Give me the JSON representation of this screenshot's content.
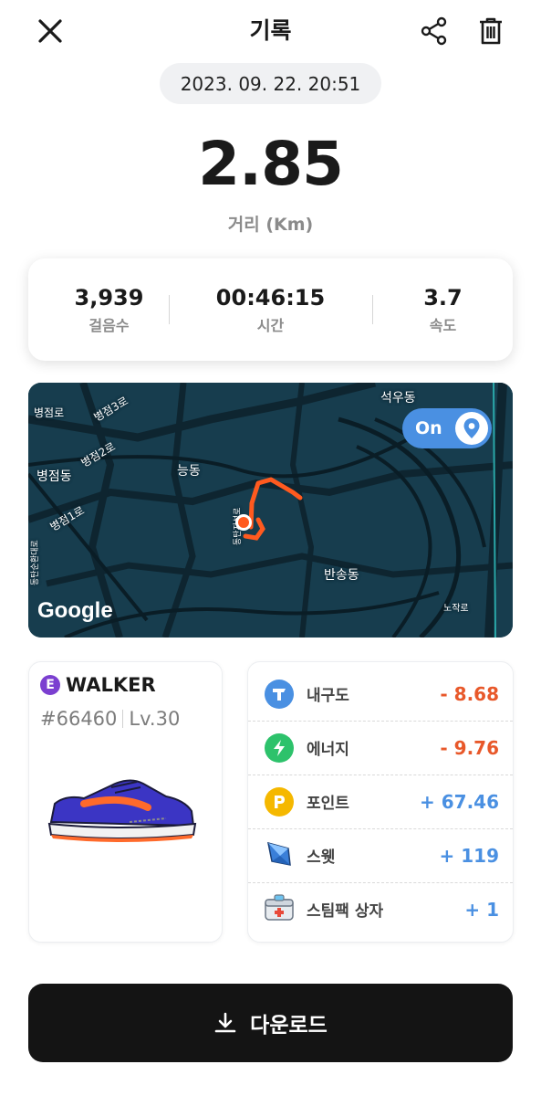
{
  "header": {
    "title": "기록"
  },
  "date": "2023. 09. 22. 20:51",
  "distance": {
    "value": "2.85",
    "label": "거리 (Km)"
  },
  "stats": [
    {
      "value": "3,939",
      "label": "걸음수"
    },
    {
      "value": "00:46:15",
      "label": "시간"
    },
    {
      "value": "3.7",
      "label": "속도"
    }
  ],
  "map": {
    "labels": [
      "석우동",
      "병점로",
      "병점3로",
      "병점2로",
      "병점동",
      "병점1로",
      "능동",
      "반송동",
      "노작로",
      "동탄순환대로",
      "동탄지성로"
    ],
    "toggle_label": "On",
    "attribution": "Google",
    "route_color": "#ff5a1f"
  },
  "shoe": {
    "badge": "E",
    "name": "WALKER",
    "id": "#66460",
    "level": "Lv.30"
  },
  "rewards": [
    {
      "icon": "durability-icon",
      "label": "내구도",
      "value": "- 8.68",
      "color": "#4a90e2"
    },
    {
      "icon": "energy-icon",
      "label": "에너지",
      "value": "- 9.76",
      "color": "#2dc26b"
    },
    {
      "icon": "point-icon",
      "label": "포인트",
      "value": "+ 67.46",
      "color": "#f5b800"
    },
    {
      "icon": "sweat-icon",
      "label": "스웻",
      "value": "+ 119",
      "color": "#3a7fd8"
    },
    {
      "icon": "steampack-box-icon",
      "label": "스팀팩 상자",
      "value": "+ 1",
      "color": "#cfd6de"
    }
  ],
  "download": {
    "label": "다운로드"
  }
}
